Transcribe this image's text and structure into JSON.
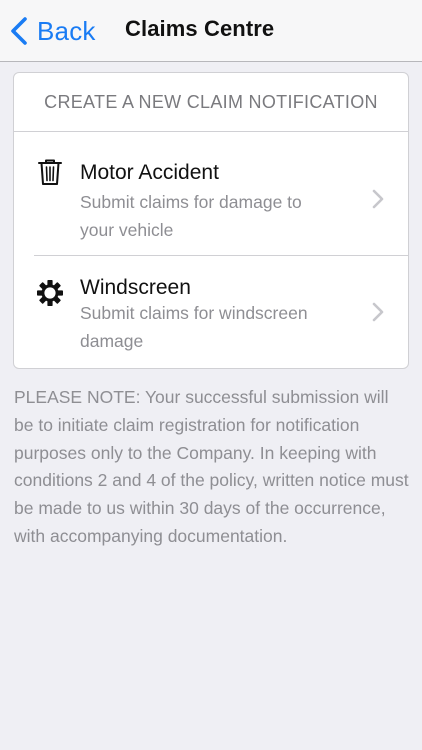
{
  "navbar": {
    "back_label": "Back",
    "title": "Claims Centre"
  },
  "card": {
    "header": "CREATE A NEW CLAIM NOTIFICATION",
    "items": [
      {
        "title": "Motor Accident",
        "subtitle": "Submit claims for damage to your vehicle",
        "icon": "trash-icon"
      },
      {
        "title": "Windscreen",
        "subtitle": "Submit claims for windscreen damage",
        "icon": "gear-icon"
      }
    ]
  },
  "note": "PLEASE NOTE: Your successful submission will be to initiate claim registration for notification purposes only to the Company. In keeping with conditions 2 and 4 of the policy, written notice must be made to us within 30 days of the occurrence, with accompanying documentation.",
  "colors": {
    "accent": "#1a7cf4",
    "background": "#efeff4",
    "secondary_text": "#8e8e93"
  }
}
